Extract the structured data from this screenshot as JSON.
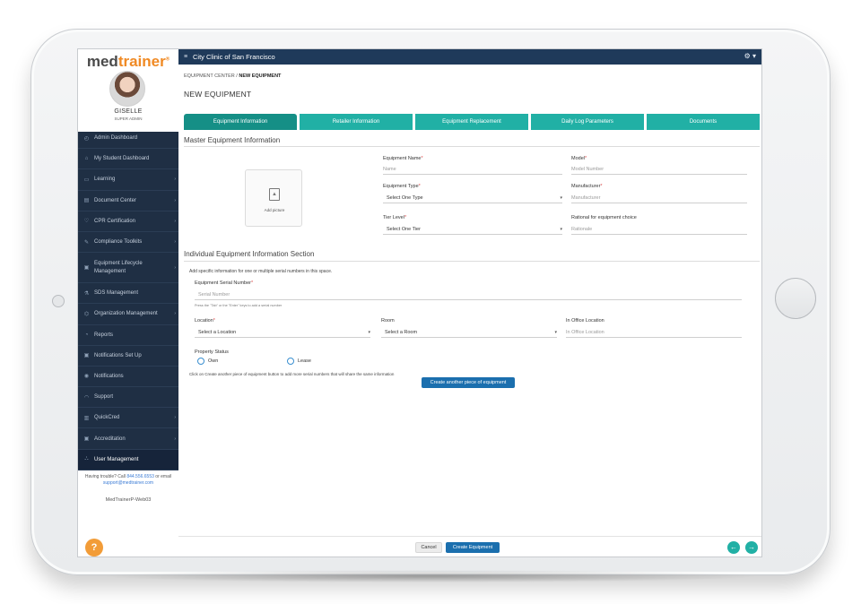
{
  "app": {
    "logo_primary": "med",
    "logo_secondary": "trainer",
    "logo_mark": "®"
  },
  "user": {
    "name": "GISELLE",
    "role": "SUPER ADMIN"
  },
  "sidebar": {
    "items": [
      {
        "label": "Admin Dashboard",
        "icon": "dashboard-icon",
        "glyph": "◴",
        "chevron": false
      },
      {
        "label": "My Student Dashboard",
        "icon": "student-icon",
        "glyph": "⌂",
        "chevron": false
      },
      {
        "label": "Learning",
        "icon": "book-icon",
        "glyph": "▭",
        "chevron": true
      },
      {
        "label": "Document Center",
        "icon": "document-icon",
        "glyph": "▤",
        "chevron": true
      },
      {
        "label": "CPR Certification",
        "icon": "heart-icon",
        "glyph": "♡",
        "chevron": true
      },
      {
        "label": "Compliance Toolkits",
        "icon": "tool-icon",
        "glyph": "✎",
        "chevron": true
      },
      {
        "label": "Equipment Lifecycle Management",
        "icon": "equipment-icon",
        "glyph": "▣",
        "chevron": true,
        "two_line": true
      },
      {
        "label": "SDS Management",
        "icon": "flask-icon",
        "glyph": "⚗",
        "chevron": false
      },
      {
        "label": "Organization Management",
        "icon": "organization-icon",
        "glyph": "⌬",
        "chevron": true
      },
      {
        "label": "Reports",
        "icon": "reports-icon",
        "glyph": "◔",
        "chevron": false
      },
      {
        "label": "Notifications Set Up",
        "icon": "notification-setup-icon",
        "glyph": "▣",
        "chevron": false
      },
      {
        "label": "Notifications",
        "icon": "notification-icon",
        "glyph": "◉",
        "chevron": false
      },
      {
        "label": "Support",
        "icon": "headset-icon",
        "glyph": "◠",
        "chevron": false
      },
      {
        "label": "QuickCred",
        "icon": "quickcred-icon",
        "glyph": "▥",
        "chevron": true
      },
      {
        "label": "Accreditation",
        "icon": "accreditation-icon",
        "glyph": "▣",
        "chevron": true
      },
      {
        "label": "User Management",
        "icon": "users-icon",
        "glyph": "⛬",
        "chevron": false,
        "active": true
      }
    ],
    "help_text": "Having trouble? Call",
    "help_phone": "844.556.6553",
    "help_or": "or email",
    "help_email": "support@medtrainer.com",
    "version": "MedTrainerP-Web03",
    "help_button": "?"
  },
  "topbar": {
    "clinic": "City Clinic of San Francisco",
    "menu_glyph": "≡",
    "gear_glyph": "⚙ ▾"
  },
  "breadcrumb": {
    "parent": "EQUIPMENT CENTER",
    "separator": "/",
    "current": "NEW EQUIPMENT"
  },
  "page_title": "NEW EQUIPMENT",
  "tabs": [
    {
      "label": "Equipment Information",
      "active": true
    },
    {
      "label": "Retailer Information"
    },
    {
      "label": "Equipment Replacement"
    },
    {
      "label": "Daily Log Parameters"
    },
    {
      "label": "Documents"
    }
  ],
  "master": {
    "title": "Master Equipment Information",
    "picture_label": "Add picture",
    "equipment_name_label": "Equipment Name",
    "equipment_name_placeholder": "Name",
    "model_label": "Model",
    "model_placeholder": "Model Number",
    "equipment_type_label": "Equipment Type",
    "equipment_type_value": "Select One Type",
    "manufacturer_label": "Manufacturer",
    "manufacturer_placeholder": "Manufacturer",
    "tier_label": "Tier Level",
    "tier_value": "Select One Tier",
    "rational_label": "Rational for equipment choice",
    "rational_placeholder": "Rationale",
    "required_mark": "*",
    "caret": "▾"
  },
  "individual": {
    "title": "Individual Equipment Information Section",
    "description": "Add specific information for one or multiple serial numbers in this space.",
    "serial_label": "Equipment Serial Number",
    "serial_placeholder": "Serial Number",
    "serial_hint": "Press the \"Tab\" or the \"Enter\" keys to add a serial number",
    "location_label": "Location",
    "location_value": "Select a Location",
    "room_label": "Room",
    "room_value": "Select a Room",
    "office_label": "In Office Location",
    "office_placeholder": "In Office Location",
    "property_label": "Property Status",
    "own_label": "Own",
    "lease_label": "Lease",
    "create_note": "Click on Create another piece of equipment button to add more serial numbers that will share the same information",
    "create_another": "Create another piece of equipment"
  },
  "footer": {
    "cancel": "Cancel",
    "create": "Create Equipment",
    "prev_glyph": "←",
    "next_glyph": "→"
  }
}
